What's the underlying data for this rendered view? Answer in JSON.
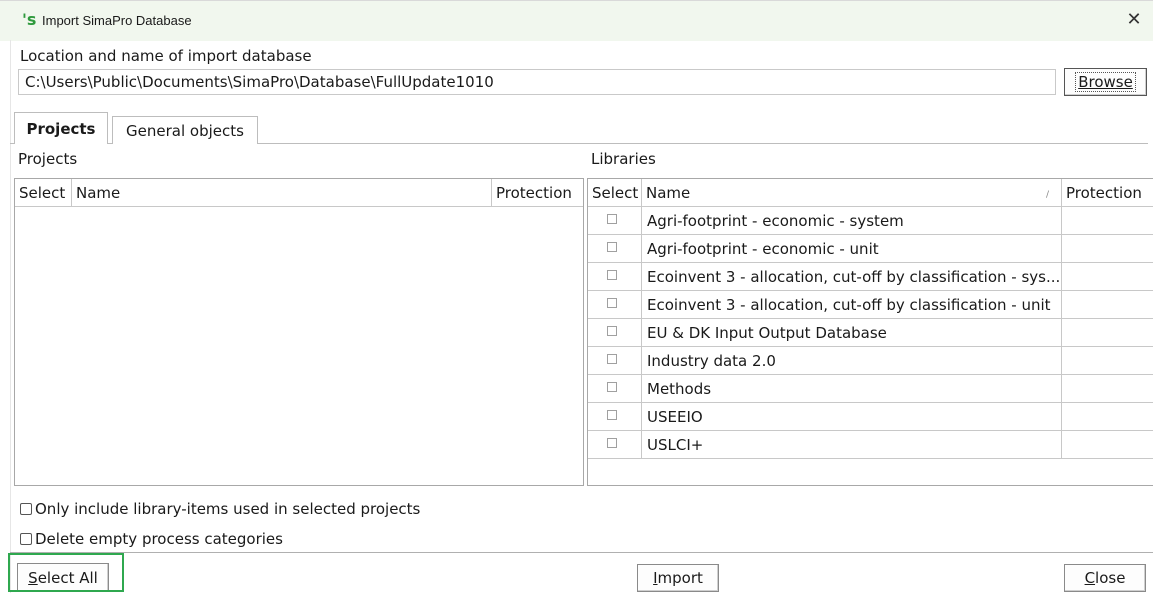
{
  "window": {
    "title": "Import SimaPro Database",
    "app_icon_glyph": "'s",
    "close_glyph": "✕"
  },
  "location": {
    "label": "Location and name of import database",
    "path": "C:\\Users\\Public\\Documents\\SimaPro\\Database\\FullUpdate1010",
    "browse_label": "Browse"
  },
  "tabs": [
    {
      "label": "Projects",
      "active": true
    },
    {
      "label": "General objects",
      "active": false
    }
  ],
  "projects": {
    "label": "Projects",
    "columns": [
      "Select",
      "Name",
      "Protection"
    ],
    "rows": []
  },
  "libraries": {
    "label": "Libraries",
    "columns": [
      "Select",
      "Name",
      "Protection"
    ],
    "sort_indicator": "/",
    "rows": [
      {
        "name": "Agri-footprint - economic - system",
        "selected": false,
        "protection": ""
      },
      {
        "name": "Agri-footprint - economic - unit",
        "selected": false,
        "protection": ""
      },
      {
        "name": "Ecoinvent 3 - allocation, cut-off by classification - sys...",
        "selected": false,
        "protection": ""
      },
      {
        "name": "Ecoinvent 3 - allocation, cut-off by classification - unit",
        "selected": false,
        "protection": ""
      },
      {
        "name": "EU & DK Input Output Database",
        "selected": false,
        "protection": ""
      },
      {
        "name": "Industry data 2.0",
        "selected": false,
        "protection": ""
      },
      {
        "name": "Methods",
        "selected": false,
        "protection": ""
      },
      {
        "name": "USEEIO",
        "selected": false,
        "protection": ""
      },
      {
        "name": "USLCI+",
        "selected": false,
        "protection": ""
      }
    ]
  },
  "options": {
    "only_include_label": "Only include library-items used in selected projects",
    "only_include_checked": false,
    "delete_empty_label": "Delete empty process categories",
    "delete_empty_checked": false
  },
  "buttons": {
    "select_all": {
      "first": "S",
      "rest": "elect All"
    },
    "import": {
      "first": "I",
      "rest": "mport"
    },
    "close": {
      "first": "C",
      "rest": "lose"
    }
  },
  "colors": {
    "titlebar_bg": "#f1f7ee",
    "highlight": "#2fa84f",
    "icon": "#2f9a3d"
  }
}
